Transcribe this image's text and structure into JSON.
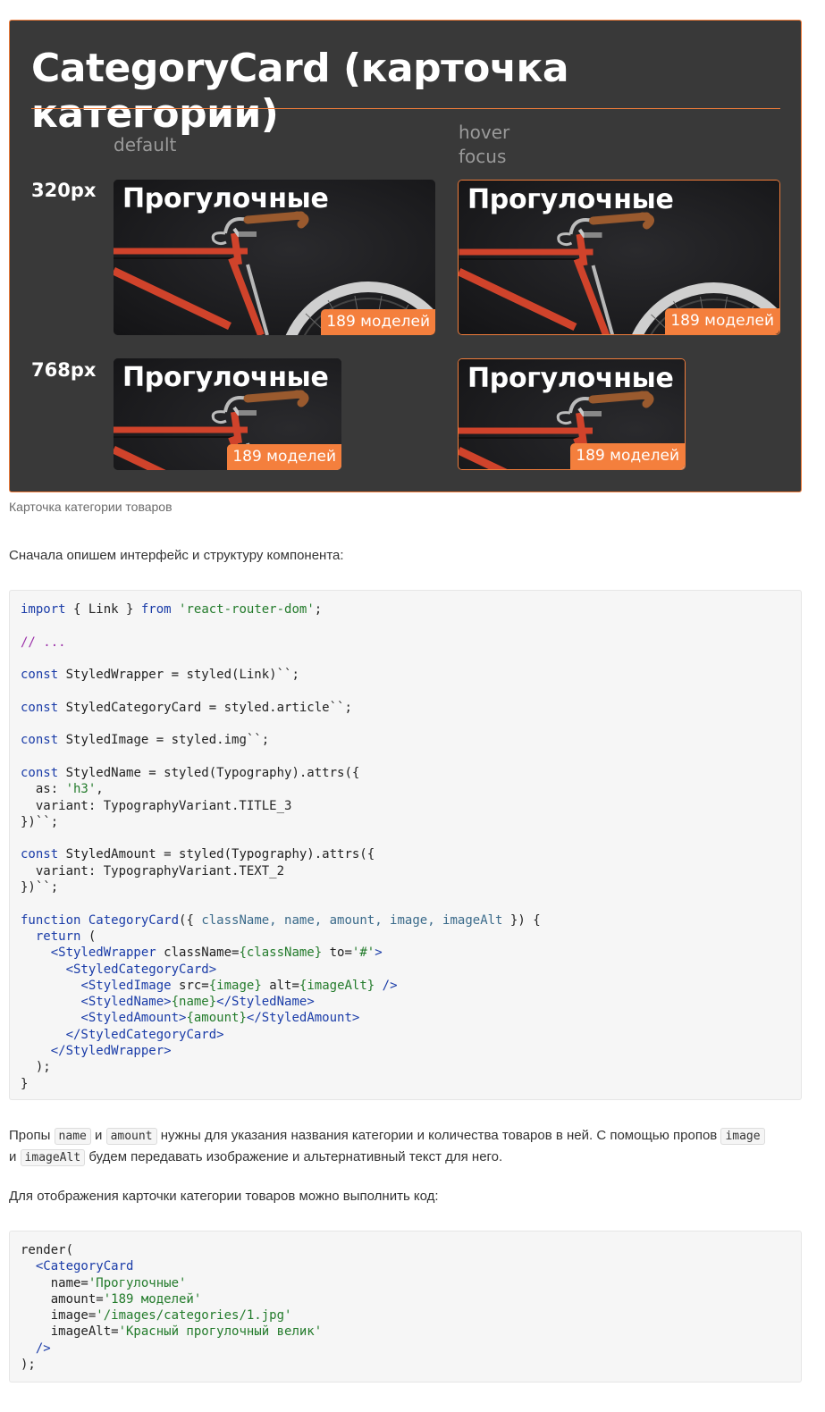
{
  "figure": {
    "title": "CategoryCard (карточка категории)",
    "state_default": "default",
    "state_hover": "hover",
    "state_focus": "focus",
    "size_320": "320px",
    "size_768": "768px",
    "card_name": "Прогулочные",
    "card_amount": "189 моделей",
    "accent_color": "#f07c3a"
  },
  "caption": "Карточка категории товаров",
  "intro": "Сначала опишем интерфейс и структуру компонента:",
  "code1_lines": [
    "import { Link } from 'react-router-dom';",
    "",
    "// ...",
    "",
    "const StyledWrapper = styled(Link)``;",
    "",
    "const StyledCategoryCard = styled.article``;",
    "",
    "const StyledImage = styled.img``;",
    "",
    "const StyledName = styled(Typography).attrs({",
    "  as: 'h3',",
    "  variant: TypographyVariant.TITLE_3",
    "})``;",
    "",
    "const StyledAmount = styled(Typography).attrs({",
    "  variant: TypographyVariant.TEXT_2",
    "})``;",
    "",
    "function CategoryCard({ className, name, amount, image, imageAlt }) {",
    "  return (",
    "    <StyledWrapper className={className} to='#'>",
    "      <StyledCategoryCard>",
    "        <StyledImage src={image} alt={imageAlt} />",
    "        <StyledName>{name}</StyledName>",
    "        <StyledAmount>{amount}</StyledAmount>",
    "      </StyledCategoryCard>",
    "    </StyledWrapper>",
    "  );",
    "}"
  ],
  "props_para": {
    "t1": "Пропы ",
    "c1": "name",
    "t2": " и ",
    "c2": "amount",
    "t3": " нужны для указания названия категории и количества товаров в ней. С помощью пропов ",
    "c3": "image",
    "t4": "и ",
    "c4": "imageAlt",
    "t5": " будем передавать изображение и альтернативный текст для него."
  },
  "render_intro": "Для отображения карточки категории товаров можно выполнить код:",
  "code2_lines": [
    "render(",
    "  <CategoryCard",
    "    name='Прогулочные'",
    "    amount='189 моделей'",
    "    image='/images/categories/1.jpg'",
    "    imageAlt='Красный прогулочный велик'",
    "  />",
    ");"
  ]
}
